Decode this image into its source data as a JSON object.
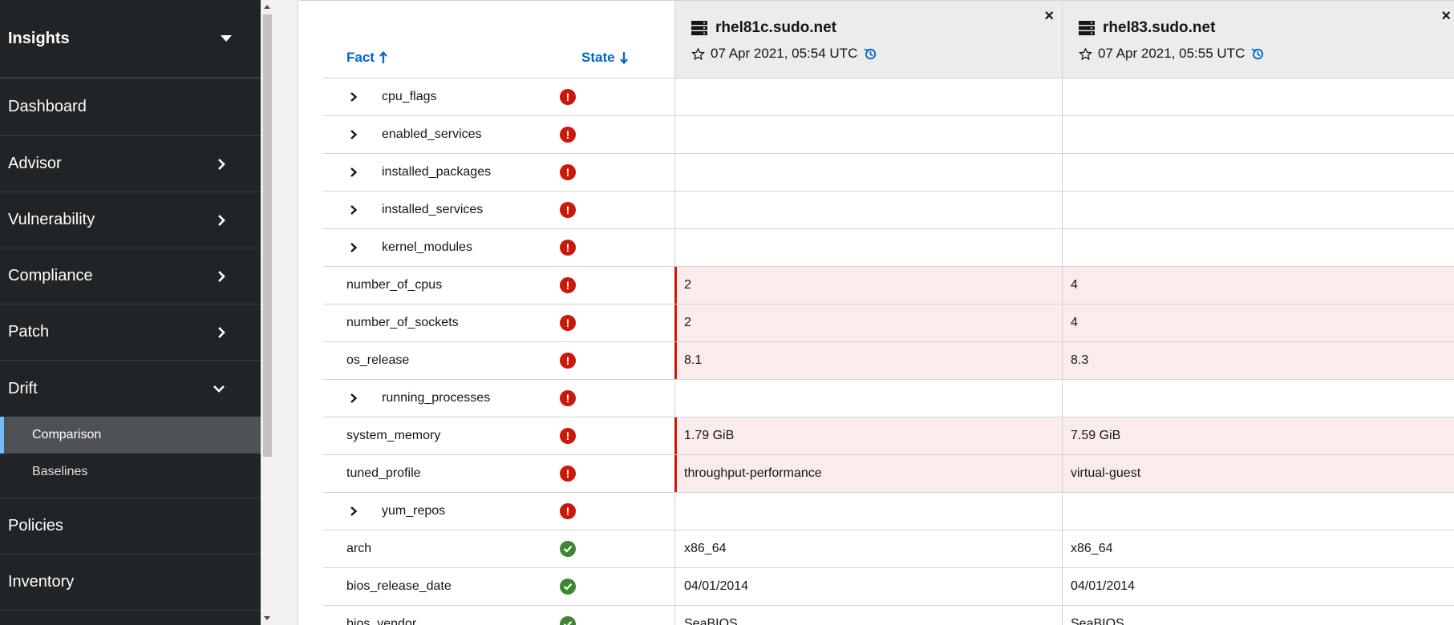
{
  "sidebar": {
    "app_title": "Insights",
    "items": [
      {
        "label": "Dashboard"
      },
      {
        "label": "Advisor"
      },
      {
        "label": "Vulnerability"
      },
      {
        "label": "Compliance"
      },
      {
        "label": "Patch"
      },
      {
        "label": "Drift"
      },
      {
        "label": "Policies"
      },
      {
        "label": "Inventory"
      }
    ],
    "drift_sub": [
      {
        "label": "Comparison",
        "active": true
      },
      {
        "label": "Baselines",
        "active": false
      }
    ]
  },
  "table": {
    "fact_header": "Fact",
    "state_header": "State",
    "systems": [
      {
        "name": "rhel81c.sudo.net",
        "date": "07 Apr 2021, 05:54 UTC"
      },
      {
        "name": "rhel83.sudo.net",
        "date": "07 Apr 2021, 05:55 UTC"
      }
    ],
    "rows": [
      {
        "fact": "cpu_flags",
        "expandable": true,
        "state": "error",
        "v1": "",
        "v2": ""
      },
      {
        "fact": "enabled_services",
        "expandable": true,
        "state": "error",
        "v1": "",
        "v2": ""
      },
      {
        "fact": "installed_packages",
        "expandable": true,
        "state": "error",
        "v1": "",
        "v2": ""
      },
      {
        "fact": "installed_services",
        "expandable": true,
        "state": "error",
        "v1": "",
        "v2": ""
      },
      {
        "fact": "kernel_modules",
        "expandable": true,
        "state": "error",
        "v1": "",
        "v2": ""
      },
      {
        "fact": "number_of_cpus",
        "expandable": false,
        "state": "error",
        "v1": "2",
        "v2": "4"
      },
      {
        "fact": "number_of_sockets",
        "expandable": false,
        "state": "error",
        "v1": "2",
        "v2": "4"
      },
      {
        "fact": "os_release",
        "expandable": false,
        "state": "error",
        "v1": "8.1",
        "v2": "8.3"
      },
      {
        "fact": "running_processes",
        "expandable": true,
        "state": "error",
        "v1": "",
        "v2": ""
      },
      {
        "fact": "system_memory",
        "expandable": false,
        "state": "error",
        "v1": "1.79 GiB",
        "v2": "7.59 GiB"
      },
      {
        "fact": "tuned_profile",
        "expandable": false,
        "state": "error",
        "v1": "throughput-performance",
        "v2": "virtual-guest"
      },
      {
        "fact": "yum_repos",
        "expandable": true,
        "state": "error",
        "v1": "",
        "v2": ""
      },
      {
        "fact": "arch",
        "expandable": false,
        "state": "ok",
        "v1": "x86_64",
        "v2": "x86_64"
      },
      {
        "fact": "bios_release_date",
        "expandable": false,
        "state": "ok",
        "v1": "04/01/2014",
        "v2": "04/01/2014"
      },
      {
        "fact": "bios_vendor",
        "expandable": false,
        "state": "ok",
        "v1": "SeaBIOS",
        "v2": "SeaBIOS"
      }
    ]
  },
  "colors": {
    "sidebar_bg": "#212427",
    "link_blue": "#0066cc",
    "error_red": "#c9190b",
    "ok_green": "#3e8635",
    "diff_bg": "#fbecec"
  }
}
